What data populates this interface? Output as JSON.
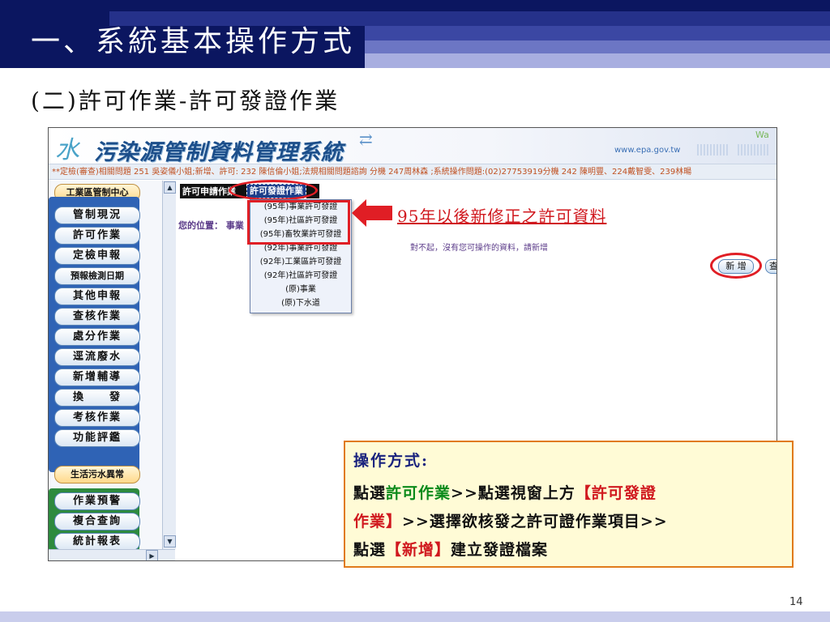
{
  "slide": {
    "title": "一、系統基本操作方式",
    "subtitle": "(二)許可作業-許可發證作業",
    "page_number": "14"
  },
  "app": {
    "logo_char": "水",
    "logo_title": "污染源管制資料管理系統",
    "url": "www.epa.gov.tw",
    "tag": "Wa",
    "notice": "**定檢(審查)相關問題 251 吳姿儀小姐;新增、許可: 232 陳信倫小姐;法規相關問題諮詢 分機 247周林森 ;系統操作問題:(02)27753919分機 242 陳明豐、224戴智雯、239林暘"
  },
  "sidebar": {
    "header": "工業區管制中心",
    "blue_items": [
      "管制現況",
      "許可作業",
      "定檢申報",
      "預報檢測日期",
      "其他申報",
      "查核作業",
      "處分作業",
      "逕流廢水",
      "新增輔導",
      "換　　發",
      "考核作業",
      "功能評鑑"
    ],
    "section2_header": "生活污水異常",
    "green_items": [
      "作業預警",
      "複合查詢",
      "統計報表"
    ]
  },
  "main": {
    "tab_permit_apply": "許可申請作業",
    "tab_permit_issue": "許可發證作業",
    "location_label": "您的位置： 事業",
    "dropdown_items": [
      "(95年)事業許可發證",
      "(95年)社區許可發證",
      "(95年)畜牧業許可發證",
      "(92年)事業許可發證",
      "(92年)工業區許可發證",
      "(92年)社區許可發證",
      "(原)事業",
      "(原)下水道"
    ],
    "message": "對不起，沒有您可操作的資料，請新增",
    "add_button": "新 增",
    "add_button2": "查"
  },
  "callout": {
    "text": "95年以後新修正之許可資料"
  },
  "instructions": {
    "title": "操作方式:",
    "line1_a": "點選",
    "line1_b": "許可作業",
    "line1_c": ">>點選視窗上方",
    "line1_d": "【許可發證",
    "line2_a": "作業】",
    "line2_b": ">>選擇欲核發之許可證作業項目>>",
    "line3_a": "點選",
    "line3_b": "【新增】",
    "line3_c": "建立發證檔案"
  },
  "colors": {
    "title_bar": "#0b1660",
    "highlight_red": "#e01e25",
    "callout_text": "#d0181e",
    "instruction_green": "#0a8a1a"
  }
}
